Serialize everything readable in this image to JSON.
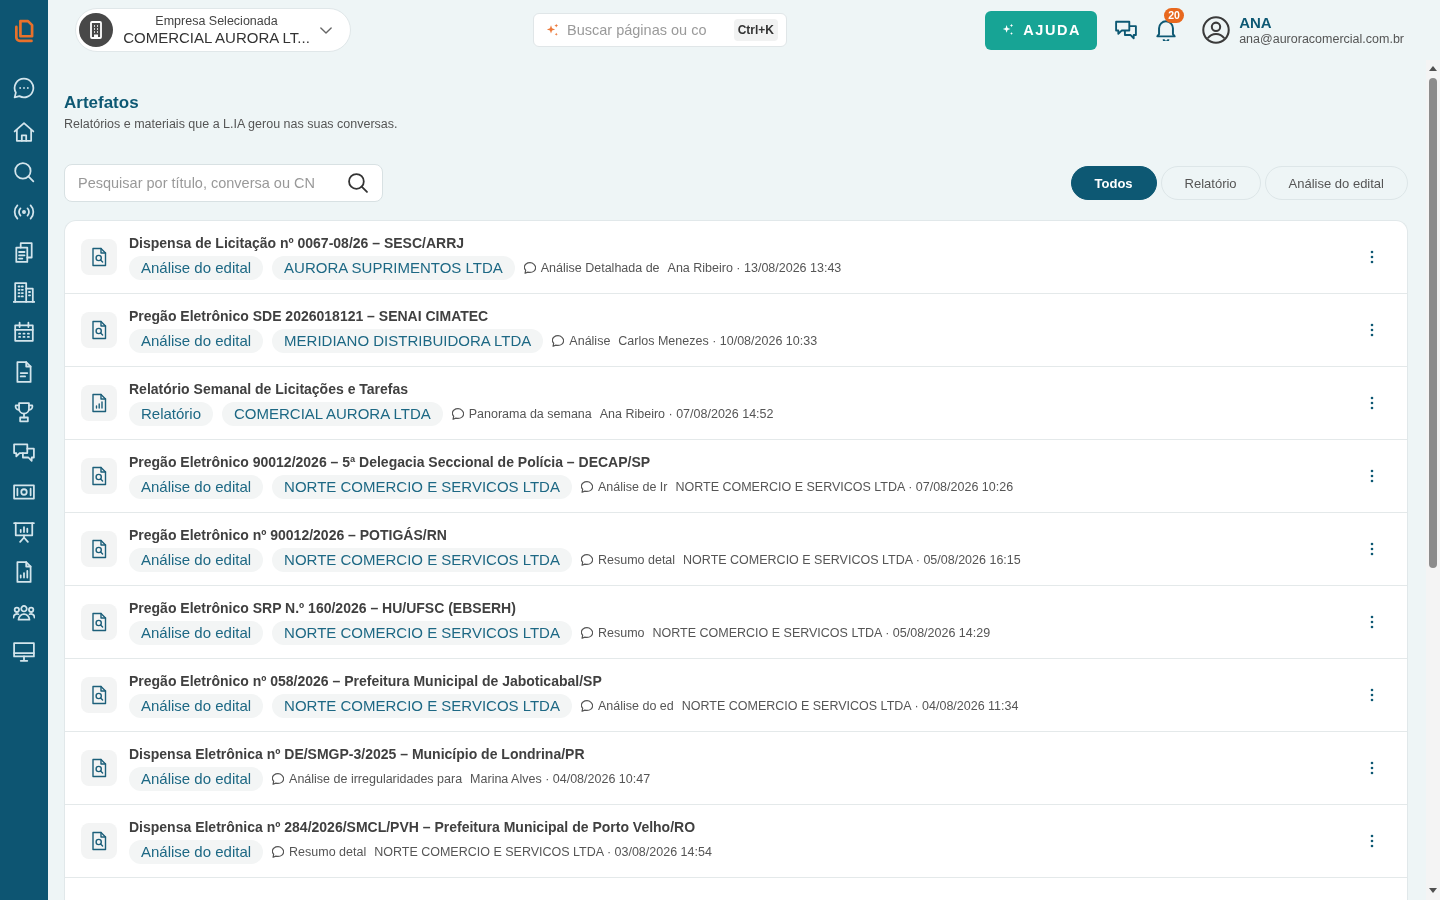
{
  "company_selector": {
    "label": "Empresa Selecionada",
    "value": "COMERCIAL AURORA LT..."
  },
  "global_search": {
    "placeholder": "Buscar páginas ou co",
    "shortcut": "Ctrl+K"
  },
  "help_button": {
    "label": "AJUDA"
  },
  "notifications": {
    "count": "20"
  },
  "user": {
    "name": "ANA",
    "email": "ana@auroracomercial.com.br"
  },
  "page": {
    "title": "Artefatos",
    "subtitle": "Relatórios e materiais que a L.IA gerou nas suas conversas."
  },
  "search": {
    "placeholder": "Pesquisar por título, conversa ou CN"
  },
  "filters": [
    {
      "label": "Todos",
      "selected": true
    },
    {
      "label": "Relatório",
      "selected": false
    },
    {
      "label": "Análise do edital",
      "selected": false
    }
  ],
  "artifacts": [
    {
      "kind": "analysis",
      "title": "Dispensa de Licitação nº 0067-08/26 – SESC/ARRJ",
      "tags": [
        "Análise do edital",
        "AURORA SUPRIMENTOS LTDA"
      ],
      "conversation": "Análise Detalhada de",
      "byline": "Ana Ribeiro · 13/08/2026 13:43"
    },
    {
      "kind": "analysis",
      "title": "Pregão Eletrônico SDE 2026018121 – SENAI CIMATEC",
      "tags": [
        "Análise do edital",
        "MERIDIANO DISTRIBUIDORA LTDA"
      ],
      "conversation": "Análise",
      "byline": "Carlos Menezes · 10/08/2026 10:33"
    },
    {
      "kind": "report",
      "title": "Relatório Semanal de Licitações e Tarefas",
      "tags": [
        "Relatório",
        "COMERCIAL AURORA LTDA"
      ],
      "conversation": "Panorama da semana",
      "byline": "Ana Ribeiro · 07/08/2026 14:52"
    },
    {
      "kind": "analysis",
      "title": "Pregão Eletrônico 90012/2026 – 5ª Delegacia Seccional de Polícia – DECAP/SP",
      "tags": [
        "Análise do edital",
        "NORTE COMERCIO E SERVICOS LTDA"
      ],
      "conversation": "Análise de Ir",
      "byline": "NORTE COMERCIO E SERVICOS LTDA · 07/08/2026 10:26"
    },
    {
      "kind": "analysis",
      "title": "Pregão Eletrônico nº 90012/2026 – POTIGÁS/RN",
      "tags": [
        "Análise do edital",
        "NORTE COMERCIO E SERVICOS LTDA"
      ],
      "conversation": "Resumo detal",
      "byline": "NORTE COMERCIO E SERVICOS LTDA · 05/08/2026 16:15"
    },
    {
      "kind": "analysis",
      "title": "Pregão Eletrônico SRP N.º 160/2026 – HU/UFSC (EBSERH)",
      "tags": [
        "Análise do edital",
        "NORTE COMERCIO E SERVICOS LTDA"
      ],
      "conversation": "Resumo",
      "byline": "NORTE COMERCIO E SERVICOS LTDA · 05/08/2026 14:29"
    },
    {
      "kind": "analysis",
      "title": "Pregão Eletrônico nº 058/2026 – Prefeitura Municipal de Jaboticabal/SP",
      "tags": [
        "Análise do edital",
        "NORTE COMERCIO E SERVICOS LTDA"
      ],
      "conversation": "Análise do ed",
      "byline": "NORTE COMERCIO E SERVICOS LTDA · 04/08/2026 11:34"
    },
    {
      "kind": "analysis",
      "title": "Dispensa Eletrônica nº DE/SMGP-3/2025 – Município de Londrina/PR",
      "tags": [
        "Análise do edital"
      ],
      "conversation": "Análise de irregularidades para",
      "byline": "Marina Alves · 04/08/2026 10:47"
    },
    {
      "kind": "analysis",
      "title": "Dispensa Eletrônica nº 284/2026/SMCL/PVH – Prefeitura Municipal de Porto Velho/RO",
      "tags": [
        "Análise do edital"
      ],
      "conversation": "Resumo detal",
      "byline": "NORTE COMERCIO E SERVICOS LTDA · 03/08/2026 14:54"
    }
  ]
}
